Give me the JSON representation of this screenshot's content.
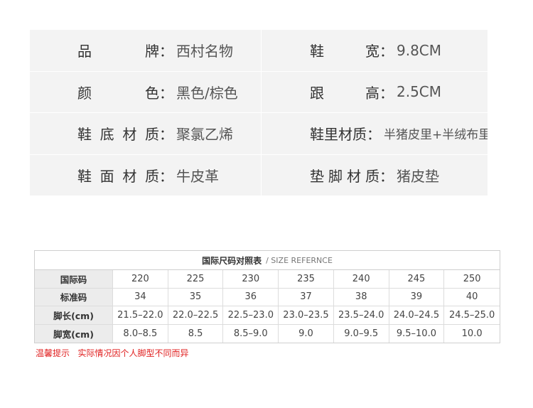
{
  "specs": {
    "rows": [
      {
        "left": {
          "label": "品牌",
          "value": "西村名物"
        },
        "right": {
          "label": "鞋宽",
          "value": "9.8CM"
        }
      },
      {
        "left": {
          "label": "颜色",
          "value": "黑色/棕色"
        },
        "right": {
          "label": "跟高",
          "value": "2.5CM"
        }
      },
      {
        "left": {
          "label": "鞋底材质",
          "value": "聚氯乙烯"
        },
        "right": {
          "label": "鞋里材质",
          "value": "半猪皮里+半绒布里"
        }
      },
      {
        "left": {
          "label": "鞋面材质",
          "value": "牛皮革"
        },
        "right": {
          "label": "垫脚材质",
          "value": "猪皮垫"
        }
      }
    ],
    "colon": "："
  },
  "size_table": {
    "title_cn": "国际尺码对照表",
    "title_en": "/ SIZE REFERNCE",
    "rows": [
      {
        "head": "国际码",
        "cells": [
          "220",
          "225",
          "230",
          "235",
          "240",
          "245",
          "250"
        ]
      },
      {
        "head": "标准码",
        "cells": [
          "34",
          "35",
          "36",
          "37",
          "38",
          "39",
          "40"
        ]
      },
      {
        "head": "脚长(cm)",
        "cells": [
          "21.5–22.0",
          "22.0–22.5",
          "22.5–23.0",
          "23.0–23.5",
          "23.5–24.0",
          "24.0–24.5",
          "24.5–25.0"
        ]
      },
      {
        "head": "脚宽(cm)",
        "cells": [
          "8.0–8.5",
          "8.5",
          "8.5–9.0",
          "9.0",
          "9.0–9.5",
          "9.5–10.0",
          "10.0"
        ]
      }
    ]
  },
  "note": "温馨提示   实际情况因个人脚型不同而异",
  "colors": {
    "cell_bg": "#f3f3f3",
    "header_bg": "#ececec",
    "note": "#e02020"
  }
}
